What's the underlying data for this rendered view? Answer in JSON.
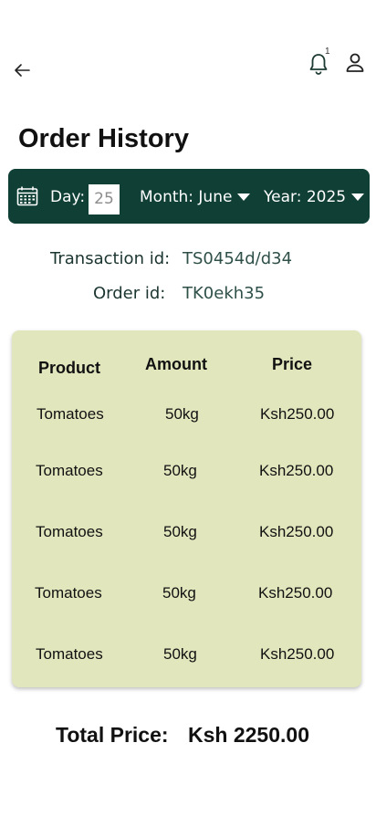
{
  "header": {
    "back_icon": "arrow-left-icon",
    "notification_badge": "1",
    "bell_icon": "bell-icon",
    "user_icon": "user-icon"
  },
  "page": {
    "title": "Order History"
  },
  "filter": {
    "calendar_icon": "calendar-icon",
    "day_label": "Day:",
    "day_value": "25",
    "month_label": "Month: June",
    "year_label": "Year: 2025",
    "background": "#0f3f35"
  },
  "info": {
    "transaction_label": "Transaction id:",
    "transaction_value": "TS0454d/d34",
    "order_label": "Order id:",
    "order_value": "TK0ekh35"
  },
  "table": {
    "headers": {
      "product": "Product",
      "amount": "Amount",
      "price": "Price"
    },
    "rows": [
      {
        "product": "Tomatoes",
        "amount": "50kg",
        "price": "Ksh250.00"
      },
      {
        "product": "Tomatoes",
        "amount": "50kg",
        "price": "Ksh250.00"
      },
      {
        "product": "Tomatoes",
        "amount": "50kg",
        "price": "Ksh250.00"
      },
      {
        "product": "Tomatoes",
        "amount": "50kg",
        "price": "Ksh250.00"
      },
      {
        "product": "Tomatoes",
        "amount": "50kg",
        "price": "Ksh250.00"
      }
    ],
    "background": "#e1e6bd"
  },
  "total": {
    "label": "Total Price:",
    "value": "Ksh 2250.00"
  }
}
